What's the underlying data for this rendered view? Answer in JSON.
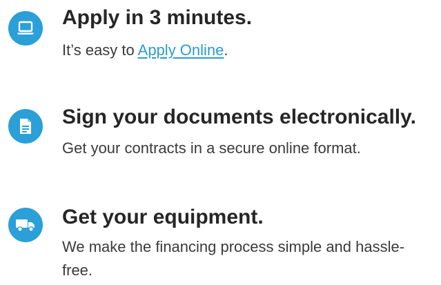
{
  "colors": {
    "icon_background": "#2b9fd8",
    "icon_foreground": "#ffffff",
    "link": "#2a9bd5",
    "title_text": "#262626",
    "body_text": "#3a3a3a"
  },
  "steps": [
    {
      "icon": "laptop-icon",
      "title": "Apply in 3 minutes.",
      "desc_prefix": "It’s easy to ",
      "link_text": "Apply Online",
      "desc_suffix": "."
    },
    {
      "icon": "document-icon",
      "title": "Sign your documents electronically.",
      "desc": "Get your contracts in a secure online format."
    },
    {
      "icon": "truck-icon",
      "title": "Get your equipment.",
      "desc": "We make the financing process simple and hassle-free."
    }
  ]
}
